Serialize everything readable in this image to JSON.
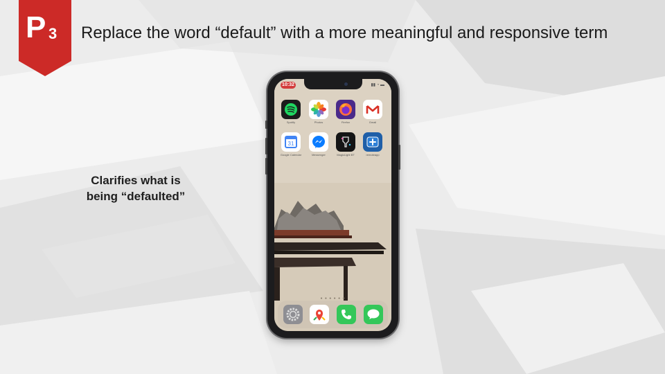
{
  "badge": {
    "letter": "P",
    "sub": "3",
    "color": "#cc2a27"
  },
  "title": "Replace the word “default” with a more meaningful and responsive term",
  "caption": {
    "line1": "Clarifies what is",
    "line2": "being “defaulted”"
  },
  "phone": {
    "time": "10:32",
    "apps": [
      {
        "icon": "spotify-icon",
        "label": "Spotify",
        "color": "#1c1c1c"
      },
      {
        "icon": "photos-icon",
        "label": "Photos",
        "color": "#ffffff"
      },
      {
        "icon": "firefox-icon",
        "label": "Firefox",
        "color": "#4a2a8a"
      },
      {
        "icon": "gmail-icon",
        "label": "Gmail",
        "color": "#ffffff"
      },
      {
        "icon": "google-calendar-icon",
        "label": "Google Calendar",
        "color": "#ffffff"
      },
      {
        "icon": "messenger-icon",
        "label": "Messenger",
        "color": "#ffffff"
      },
      {
        "icon": "magiclight-icon",
        "label": "MagicLight BT",
        "color": "#151515"
      },
      {
        "icon": "remoteapp-icon",
        "label": "remoteapp",
        "color": "#1f5fa8"
      }
    ],
    "dock": [
      {
        "icon": "settings-icon",
        "color": "#8e8e93"
      },
      {
        "icon": "google-maps-icon",
        "color": "#ffffff"
      },
      {
        "icon": "phone-icon",
        "color": "#34c759"
      },
      {
        "icon": "messages-icon",
        "color": "#34c759"
      }
    ]
  }
}
